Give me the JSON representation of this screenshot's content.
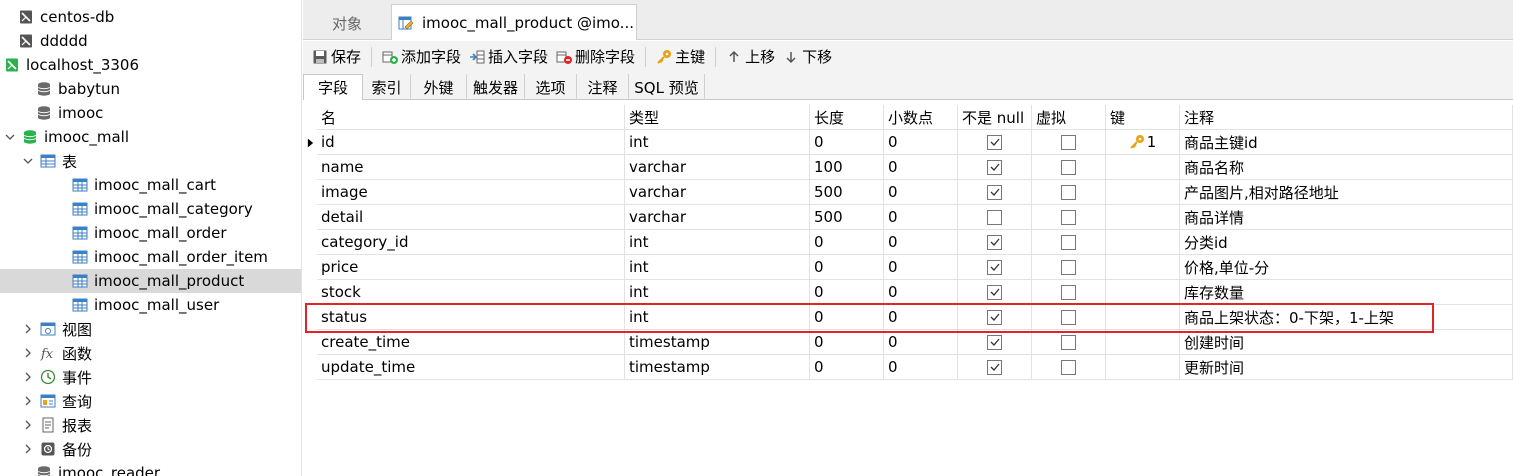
{
  "sidebar": {
    "items": [
      {
        "label": "centos-db",
        "icon": "server-icon"
      },
      {
        "label": "ddddd",
        "icon": "server-icon"
      },
      {
        "label": "localhost_3306",
        "icon": "server-connected-icon"
      },
      {
        "label": "babytun",
        "icon": "database-icon"
      },
      {
        "label": "imooc",
        "icon": "database-icon"
      },
      {
        "label": "imooc_mall",
        "icon": "database-open-icon"
      },
      {
        "label": "表",
        "icon": "tables-icon"
      },
      {
        "label": "imooc_mall_cart",
        "icon": "table-icon"
      },
      {
        "label": "imooc_mall_category",
        "icon": "table-icon"
      },
      {
        "label": "imooc_mall_order",
        "icon": "table-icon"
      },
      {
        "label": "imooc_mall_order_item",
        "icon": "table-icon"
      },
      {
        "label": "imooc_mall_product",
        "icon": "table-icon",
        "selected": true
      },
      {
        "label": "imooc_mall_user",
        "icon": "table-icon"
      },
      {
        "label": "视图",
        "icon": "views-icon"
      },
      {
        "label": "函数",
        "icon": "function-icon"
      },
      {
        "label": "事件",
        "icon": "event-icon"
      },
      {
        "label": "查询",
        "icon": "query-icon"
      },
      {
        "label": "报表",
        "icon": "report-icon"
      },
      {
        "label": "备份",
        "icon": "backup-icon"
      },
      {
        "label": "imooc_reader",
        "icon": "database-icon"
      }
    ]
  },
  "tabs": {
    "objects_label": "对象",
    "doc_label": "imooc_mall_product @imo..."
  },
  "toolbar": {
    "save": "保存",
    "add_field": "添加字段",
    "insert_field": "插入字段",
    "delete_field": "删除字段",
    "primary_key": "主键",
    "move_up": "上移",
    "move_down": "下移"
  },
  "subtabs": [
    "字段",
    "索引",
    "外键",
    "触发器",
    "选项",
    "注释",
    "SQL 预览"
  ],
  "grid": {
    "headers": {
      "name": "名",
      "type": "类型",
      "length": "长度",
      "decimals": "小数点",
      "not_null": "不是 null",
      "virtual": "虚拟",
      "key": "键",
      "comment": "注释"
    },
    "rows": [
      {
        "name": "id",
        "type": "int",
        "length": "0",
        "decimals": "0",
        "not_null": true,
        "virtual": false,
        "key": "1",
        "comment": "商品主键id"
      },
      {
        "name": "name",
        "type": "varchar",
        "length": "100",
        "decimals": "0",
        "not_null": true,
        "virtual": false,
        "key": "",
        "comment": "商品名称"
      },
      {
        "name": "image",
        "type": "varchar",
        "length": "500",
        "decimals": "0",
        "not_null": true,
        "virtual": false,
        "key": "",
        "comment": "产品图片,相对路径地址"
      },
      {
        "name": "detail",
        "type": "varchar",
        "length": "500",
        "decimals": "0",
        "not_null": false,
        "virtual": false,
        "key": "",
        "comment": "商品详情"
      },
      {
        "name": "category_id",
        "type": "int",
        "length": "0",
        "decimals": "0",
        "not_null": true,
        "virtual": false,
        "key": "",
        "comment": "分类id"
      },
      {
        "name": "price",
        "type": "int",
        "length": "0",
        "decimals": "0",
        "not_null": true,
        "virtual": false,
        "key": "",
        "comment": "价格,单位-分"
      },
      {
        "name": "stock",
        "type": "int",
        "length": "0",
        "decimals": "0",
        "not_null": true,
        "virtual": false,
        "key": "",
        "comment": "库存数量"
      },
      {
        "name": "status",
        "type": "int",
        "length": "0",
        "decimals": "0",
        "not_null": true,
        "virtual": false,
        "key": "",
        "comment": "商品上架状态：0-下架，1-上架"
      },
      {
        "name": "create_time",
        "type": "timestamp",
        "length": "0",
        "decimals": "0",
        "not_null": true,
        "virtual": false,
        "key": "",
        "comment": "创建时间"
      },
      {
        "name": "update_time",
        "type": "timestamp",
        "length": "0",
        "decimals": "0",
        "not_null": true,
        "virtual": false,
        "key": "",
        "comment": "更新时间"
      }
    ]
  },
  "colors": {
    "highlight": "#e0242a",
    "db_green": "#2bb24c",
    "table_blue": "#3c7fc2",
    "key_gold": "#e8a317"
  }
}
